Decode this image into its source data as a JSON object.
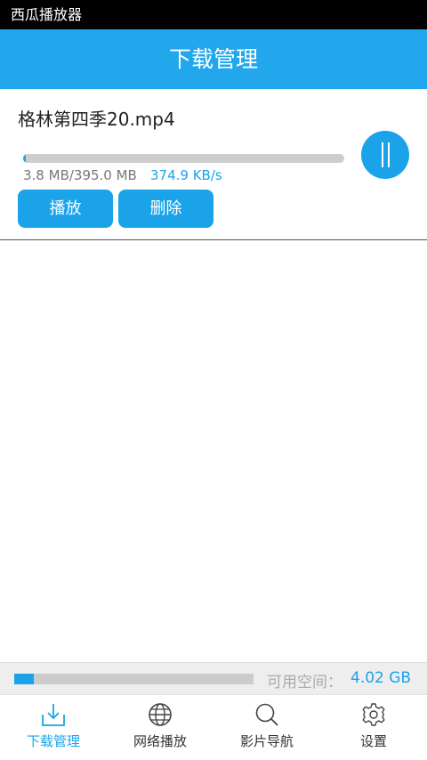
{
  "status_bar": {
    "app_name": "西瓜播放器"
  },
  "header": {
    "title": "下载管理"
  },
  "download_item": {
    "filename": "格林第四季20.mp4",
    "progress_fraction": 0.0096,
    "size_text": "3.8 MB/395.0 MB",
    "speed_text": "374.9 KB/s",
    "play_label": "播放",
    "delete_label": "删除",
    "pause_icon": "pause-icon"
  },
  "storage": {
    "label": "可用空间：",
    "value": "4.02 GB",
    "used_fraction": 0.08
  },
  "bottom_nav": {
    "items": [
      {
        "label": "下载管理",
        "icon": "download-icon",
        "active": true
      },
      {
        "label": "网络播放",
        "icon": "globe-icon",
        "active": false
      },
      {
        "label": "影片导航",
        "icon": "search-icon",
        "active": false
      },
      {
        "label": "设置",
        "icon": "gear-icon",
        "active": false
      }
    ]
  },
  "colors": {
    "accent": "#1ba3ea",
    "header": "#22a7ec"
  }
}
